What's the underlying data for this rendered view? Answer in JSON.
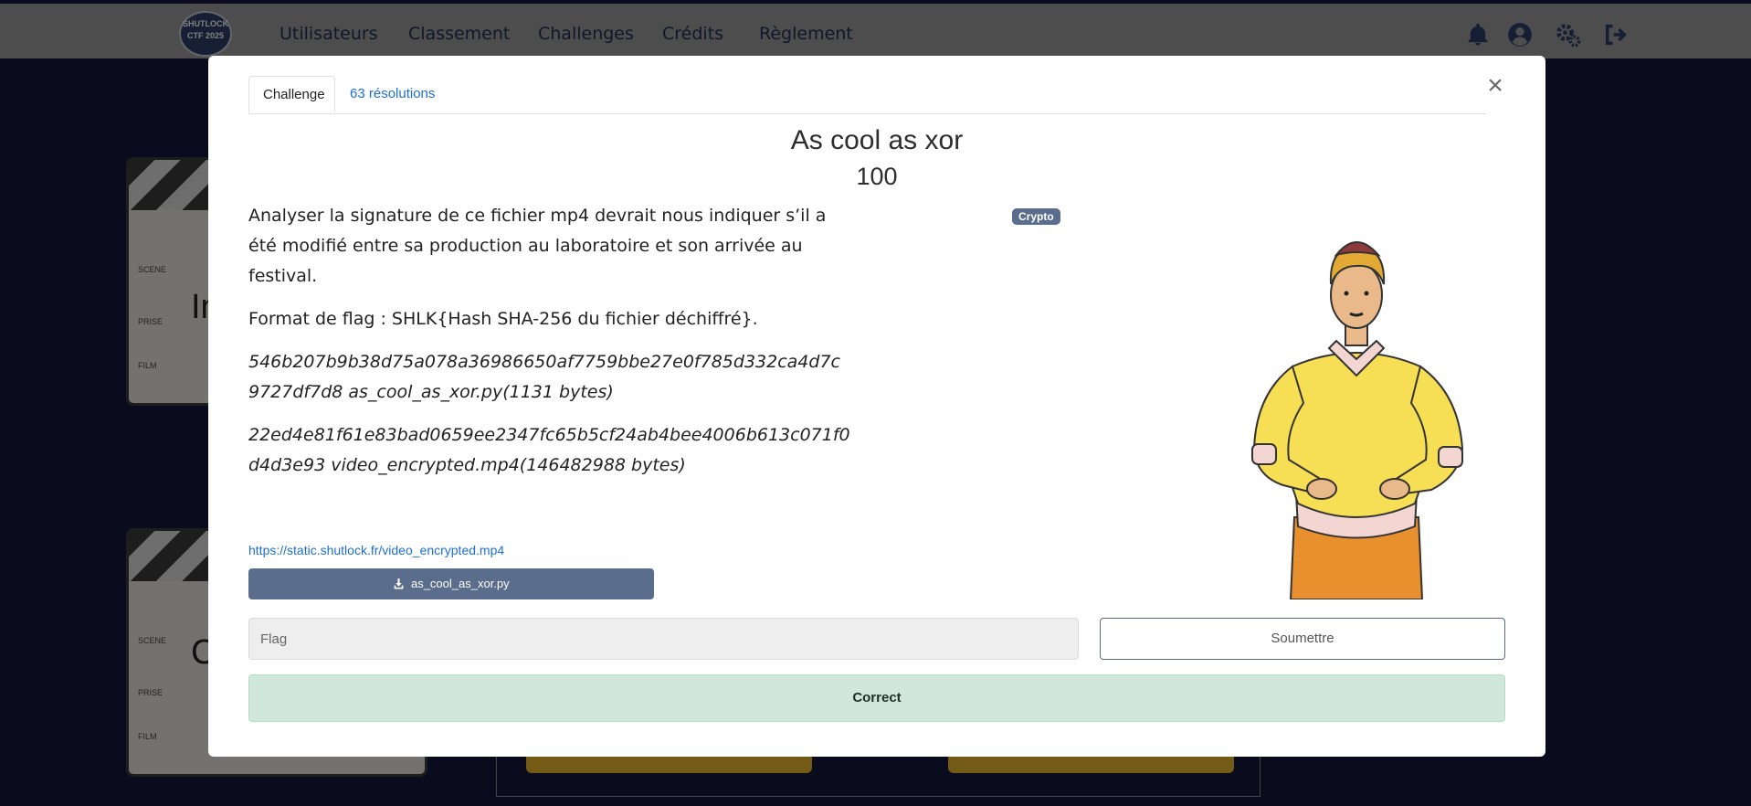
{
  "nav": {
    "logo_line1": "SHUTLOCK",
    "logo_line2": "CTF 2025",
    "items": [
      {
        "label": "Utilisateurs"
      },
      {
        "label": "Classement"
      },
      {
        "label": "Challenges"
      },
      {
        "label": "Crédits"
      },
      {
        "label": "Règlement"
      }
    ],
    "icons": [
      "bell-icon",
      "user-circle-icon",
      "gears-icon",
      "logout-icon"
    ]
  },
  "background": {
    "clapper_rows": [
      "SCENE",
      "PRISE",
      "FILM"
    ],
    "clapper_letters": [
      "In",
      "C"
    ]
  },
  "modal": {
    "tabs": [
      {
        "label": "Challenge",
        "active": true
      },
      {
        "label": "63 résolutions",
        "active": false
      }
    ],
    "title": "As cool as xor",
    "points": "100",
    "category_badge": "Crypto",
    "description": {
      "intro": "Analyser la signature de ce fichier mp4 devrait nous indiquer s’il a été modifié entre sa production au laboratoire et son arrivée au festival.",
      "flag_format": "Format de flag : SHLK{Hash SHA-256 du fichier déchiffré}.",
      "hash_1": "546b207b9b38d75a078a36986650af7759bbe27e0f785d332ca4d7c9727df7d8 as_cool_as_xor.py(1131 bytes)",
      "hash_2": "22ed4e81f61e83bad0659ee2347fc65b5cf24ab4bee4006b613c071f0d4d3e93 video_encrypted.mp4(146482988 bytes)"
    },
    "file_link": "https://static.shutlock.fr/video_encrypted.mp4",
    "download_label": "as_cool_as_xor.py",
    "flag_placeholder": "Flag",
    "submit_label": "Soumettre",
    "alert_text": "Correct"
  },
  "colors": {
    "page_bg": "#15163a",
    "nav_bg": "#9a9a9a",
    "badge_bg": "#5b6d8c",
    "link": "#1d6fd6",
    "success_bg": "#d1e7dd"
  }
}
